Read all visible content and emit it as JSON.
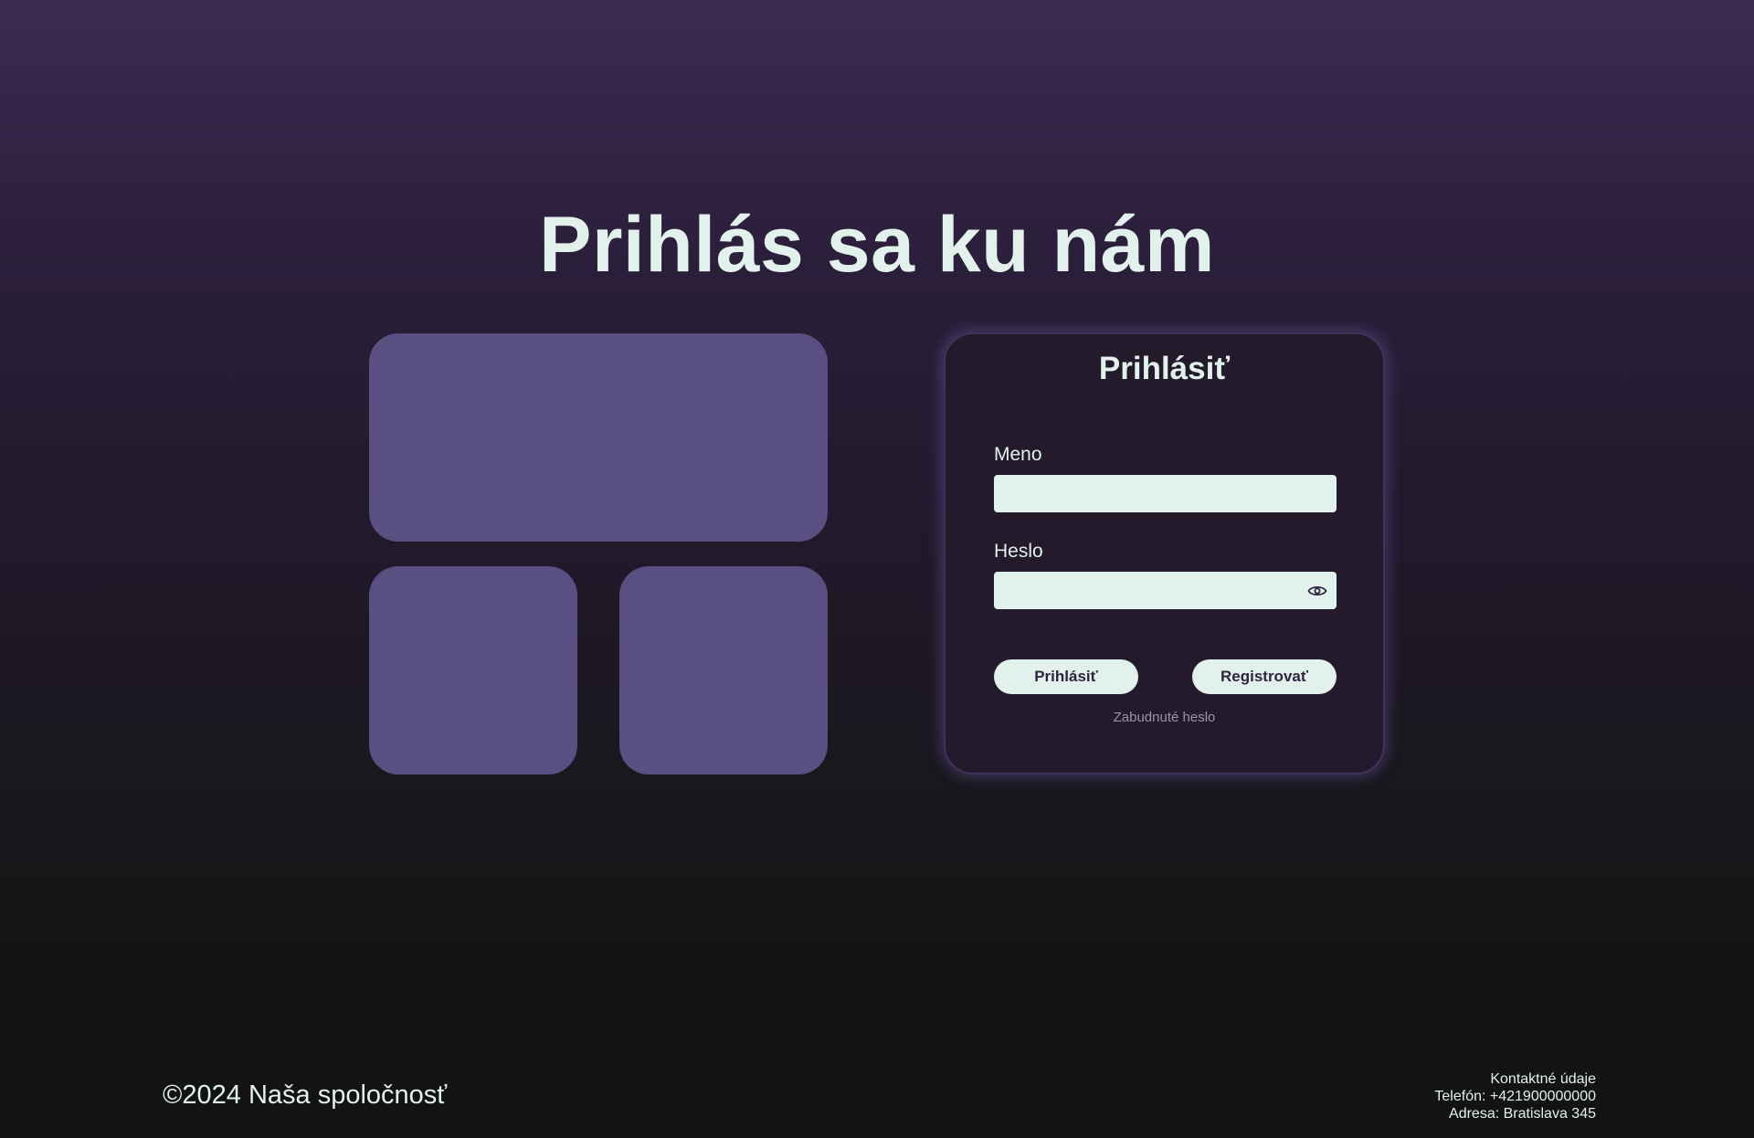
{
  "header": {
    "title": "Prihlás sa ku nám"
  },
  "login": {
    "title": "Prihlásiť",
    "name_label": "Meno",
    "name_value": "",
    "password_label": "Heslo",
    "password_value": "",
    "password_toggle_icon": "eye-icon",
    "login_button": "Prihlásiť",
    "register_button": "Registrovať",
    "forgot_password": "Zabudnuté heslo"
  },
  "footer": {
    "copyright": "©2024  Naša spoločnosť",
    "contact_title": "Kontaktné údaje",
    "phone": "Telefón: +421900000000",
    "address": "Adresa: Bratislava 345"
  },
  "colors": {
    "tile": "#594f80",
    "text_light": "#e2f1ec",
    "card_background": "#231a2b",
    "button_text": "#2e2440"
  }
}
